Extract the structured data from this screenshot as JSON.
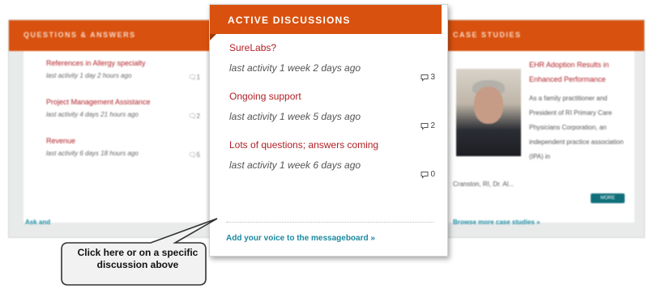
{
  "qa_panel": {
    "title": "QUESTIONS & ANSWERS",
    "items": [
      {
        "title": "References in Allergy specialty",
        "meta": "last activity 1 day 2 hours ago",
        "count": "1"
      },
      {
        "title": "Project Management Assistance",
        "meta": "last activity 4 days 21 hours ago",
        "count": "2"
      },
      {
        "title": "Revenue",
        "meta": "last activity 6 days 18 hours ago",
        "count": "5"
      }
    ],
    "footer": "Ask and"
  },
  "active_discussions": {
    "title": "ACTIVE DISCUSSIONS",
    "items": [
      {
        "title": "SureLabs?",
        "meta": "last activity 1 week 2 days ago",
        "count": "3"
      },
      {
        "title": "Ongoing support",
        "meta": "last activity 1 week 5 days ago",
        "count": "2"
      },
      {
        "title": "Lots of questions; answers coming",
        "meta": "last activity 1 week 6 days ago",
        "count": "0"
      }
    ],
    "footer_link": "Add your voice to the messageboard »"
  },
  "case_studies": {
    "title": "CASE STUDIES",
    "headline": "EHR Adoption Results in Enhanced Performance",
    "body": "As a family practitioner and President of RI Primary Care Physicians Corporation, an independent practice association (IPA) in",
    "body_cont": "Cranston, RI, Dr. Al...",
    "more_label": "MORE",
    "footer": "Browse more case studies »"
  },
  "callout": {
    "text": "Click here or on a specific discussion above"
  },
  "colors": {
    "header_orange": "#d9510e",
    "link_red": "#b01f24",
    "link_teal": "#1b8aa0"
  },
  "icons": {
    "comment": "speech-bubble-icon"
  }
}
